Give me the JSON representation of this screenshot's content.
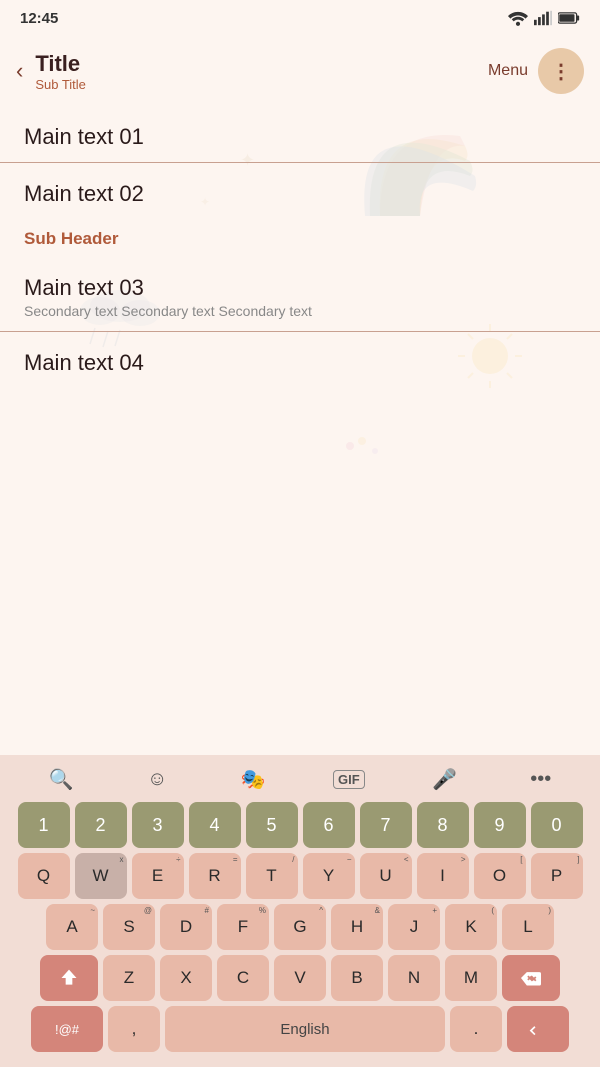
{
  "statusBar": {
    "time": "12:45",
    "wifiIcon": "wifi",
    "signalIcon": "signal",
    "batteryIcon": "battery"
  },
  "header": {
    "backIcon": "‹",
    "title": "Title",
    "subtitle": "Sub Title",
    "menuLabel": "Menu",
    "dotsIcon": "⋮"
  },
  "listItems": [
    {
      "id": 1,
      "mainText": "Main text 01",
      "secondaryText": "",
      "hasDivider": true
    },
    {
      "id": 2,
      "mainText": "Main text 02",
      "secondaryText": "",
      "hasDivider": false
    }
  ],
  "subHeader": "Sub Header",
  "listItems2": [
    {
      "id": 3,
      "mainText": "Main text 03",
      "secondaryText": "Secondary text Secondary text Secondary text",
      "hasDivider": true
    },
    {
      "id": 4,
      "mainText": "Main text 04",
      "secondaryText": "",
      "hasDivider": false
    }
  ],
  "keyboard": {
    "toolbarButtons": [
      "🔍",
      "☺",
      "🎭",
      "GIF",
      "🎤",
      "•••"
    ],
    "row1": [
      "1",
      "2",
      "3",
      "4",
      "5",
      "6",
      "7",
      "8",
      "9",
      "0"
    ],
    "row2": [
      "Q",
      "W",
      "E",
      "R",
      "T",
      "Y",
      "U",
      "I",
      "O",
      "P"
    ],
    "row3": [
      "A",
      "S",
      "D",
      "F",
      "G",
      "H",
      "J",
      "K",
      "L"
    ],
    "row4": [
      "Z",
      "X",
      "C",
      "V",
      "B",
      "N",
      "M"
    ],
    "spaceLabel": "English",
    "superscripts": {
      "Q": "",
      "W": "x",
      "E": "÷",
      "R": "=",
      "T": "/",
      "Y": "−",
      "U": "<",
      "I": ">",
      "O": "[",
      "P": "]",
      "A": "~",
      "S": "@",
      "D": "#",
      "F": "%",
      "G": "^",
      "H": "&",
      "J": "+",
      "K": "(",
      "L": ")",
      "Z": "",
      "X": "",
      "C": "",
      "V": "",
      "B": "",
      "N": "",
      "M": ""
    }
  }
}
